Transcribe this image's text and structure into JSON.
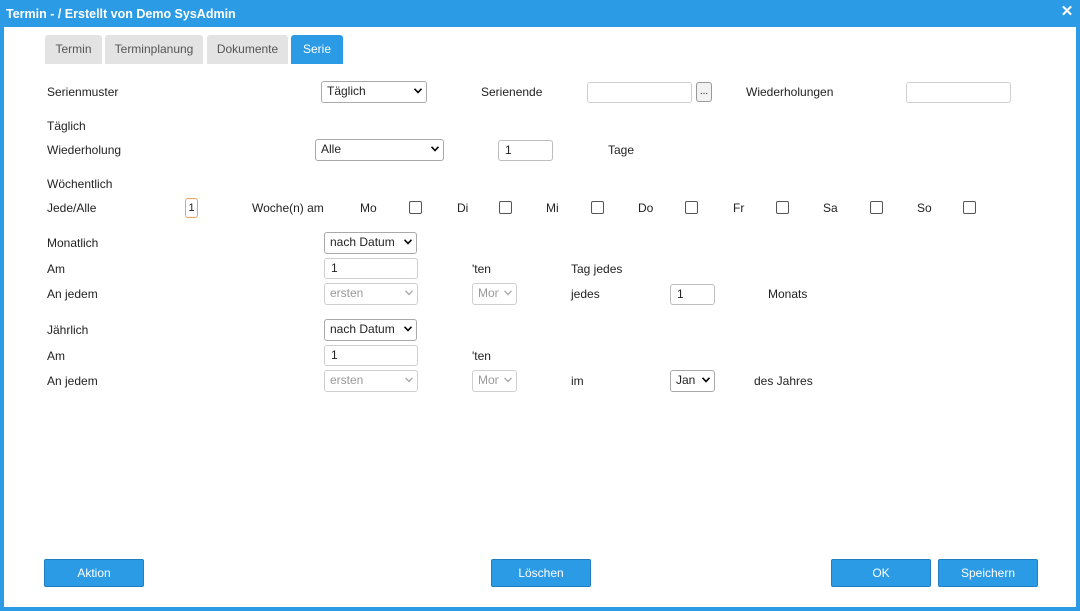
{
  "window": {
    "title": "Termin - / Erstellt von Demo SysAdmin",
    "close_glyph": "✕"
  },
  "tabs": [
    {
      "label": "Termin",
      "active": false
    },
    {
      "label": "Terminplanung",
      "active": false
    },
    {
      "label": "Dokumente",
      "active": false
    },
    {
      "label": "Serie",
      "active": true
    }
  ],
  "series": {
    "pattern_label": "Serienmuster",
    "pattern_value": "Täglich",
    "end_label": "Serienende",
    "end_value": "",
    "end_button": "...",
    "repetitions_label": "Wiederholungen",
    "repetitions_value": ""
  },
  "daily": {
    "heading": "Täglich",
    "repeat_label": "Wiederholung",
    "repeat_value": "Alle",
    "count_value": "1",
    "unit_label": "Tage"
  },
  "weekly": {
    "heading": "Wöchentlich",
    "every_label": "Jede/Alle",
    "count_value": "1",
    "weeks_label": "Woche(n) am",
    "days": [
      {
        "label": "Mo",
        "checked": false
      },
      {
        "label": "Di",
        "checked": false
      },
      {
        "label": "Mi",
        "checked": false
      },
      {
        "label": "Do",
        "checked": false
      },
      {
        "label": "Fr",
        "checked": false
      },
      {
        "label": "Sa",
        "checked": false
      },
      {
        "label": "So",
        "checked": false
      }
    ]
  },
  "monthly": {
    "heading": "Monatlich",
    "mode_value": "nach Datum",
    "on_label": "Am",
    "day_value": "1",
    "ten_suffix": "'ten",
    "day_of_label": "Tag jedes",
    "each_label": "An jedem",
    "ordinal_value": "ersten",
    "weekday_value": "Mon",
    "every_label": "jedes",
    "months_value": "1",
    "months_label": "Monats"
  },
  "yearly": {
    "heading": "Jährlich",
    "mode_value": "nach Datum",
    "on_label": "Am",
    "day_value": "1",
    "ten_suffix": "'ten",
    "each_label": "An jedem",
    "ordinal_value": "ersten",
    "weekday_value": "Mon",
    "in_label": "im",
    "month_value": "Jan",
    "year_label": "des Jahres"
  },
  "buttons": {
    "action": "Aktion",
    "delete": "Löschen",
    "ok": "OK",
    "save": "Speichern"
  },
  "colors": {
    "accent": "#2c9be5",
    "tab_inactive": "#e3e3e3"
  }
}
